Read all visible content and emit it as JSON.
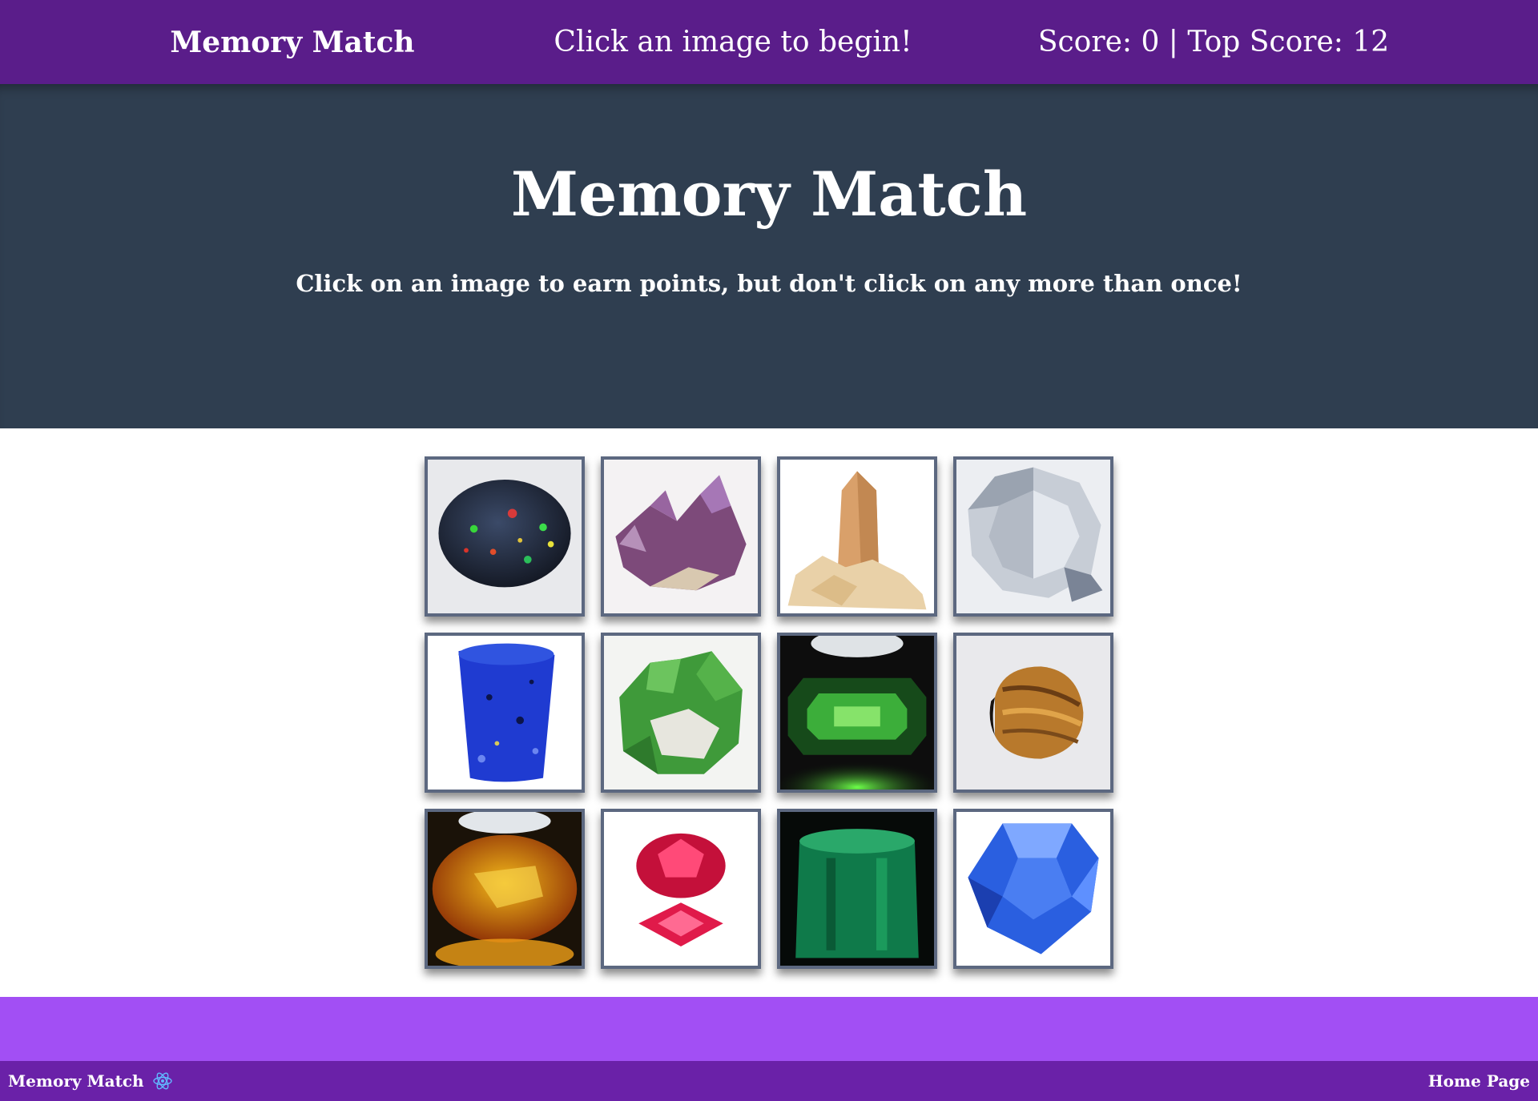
{
  "navbar": {
    "brand": "Memory Match",
    "message": "Click an image to begin!",
    "score_text": "Score: 0 | Top Score: 12"
  },
  "hero": {
    "title": "Memory Match",
    "subtitle": "Click on an image to earn points, but don't click on any more than once!"
  },
  "cards": [
    {
      "name": "black-opal"
    },
    {
      "name": "amethyst-cluster"
    },
    {
      "name": "topaz-crystal"
    },
    {
      "name": "diamond"
    },
    {
      "name": "lapis-lazuli"
    },
    {
      "name": "green-garnet-cluster"
    },
    {
      "name": "green-tourmaline"
    },
    {
      "name": "tigers-eye"
    },
    {
      "name": "citrine"
    },
    {
      "name": "ruby"
    },
    {
      "name": "emerald"
    },
    {
      "name": "sapphire"
    }
  ],
  "footer": {
    "brand": "Memory Match",
    "home_link": "Home Page",
    "brand_icon": "react-atom-icon"
  },
  "colors": {
    "navbar": "#5a1d8a",
    "hero": "#2f3e50",
    "band": "#a24ff4",
    "footer": "#6a21a8",
    "card_border": "#5c6880"
  }
}
